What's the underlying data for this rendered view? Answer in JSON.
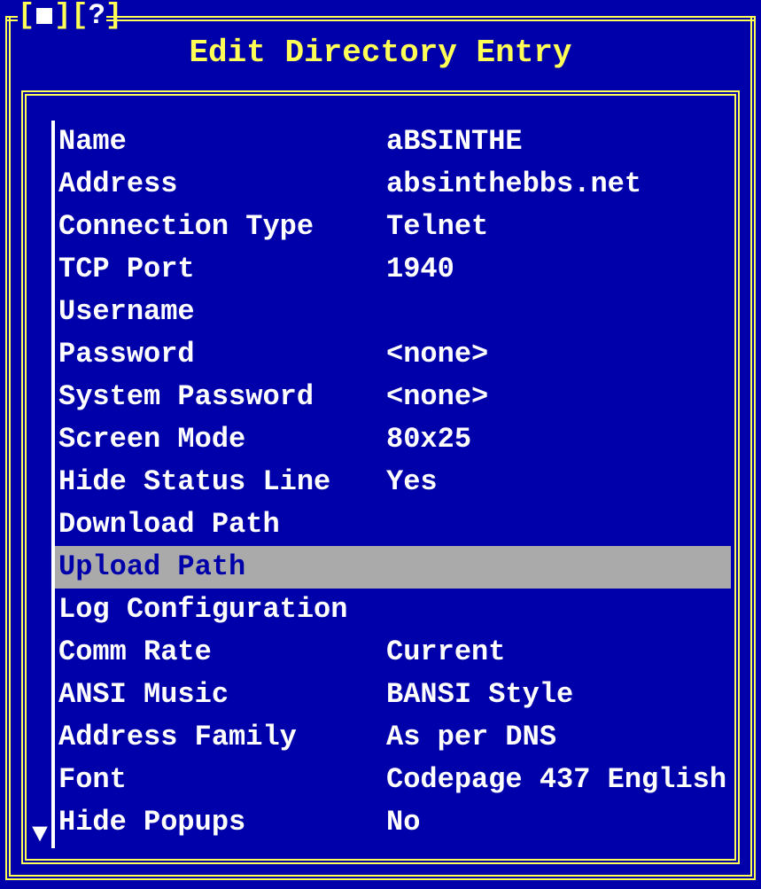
{
  "window": {
    "close_glyph": "■",
    "help_glyph": "?",
    "title": "Edit Directory Entry"
  },
  "fields": [
    {
      "label": "Name",
      "value": "aBSINTHE",
      "selected": false
    },
    {
      "label": "Address",
      "value": "absinthebbs.net",
      "selected": false
    },
    {
      "label": "Connection Type",
      "value": "Telnet",
      "selected": false
    },
    {
      "label": "TCP Port",
      "value": "1940",
      "selected": false
    },
    {
      "label": "Username",
      "value": "",
      "selected": false
    },
    {
      "label": "Password",
      "value": "<none>",
      "selected": false
    },
    {
      "label": "System Password",
      "value": "<none>",
      "selected": false
    },
    {
      "label": "Screen Mode",
      "value": "80x25",
      "selected": false
    },
    {
      "label": "Hide Status Line",
      "value": "Yes",
      "selected": false
    },
    {
      "label": "Download Path",
      "value": "",
      "selected": false
    },
    {
      "label": "Upload Path",
      "value": "",
      "selected": true
    },
    {
      "label": "Log Configuration",
      "value": "",
      "selected": false
    },
    {
      "label": "Comm Rate",
      "value": "Current",
      "selected": false
    },
    {
      "label": "ANSI Music",
      "value": "BANSI Style",
      "selected": false
    },
    {
      "label": "Address Family",
      "value": "As per DNS",
      "selected": false
    },
    {
      "label": "Font",
      "value": "Codepage 437 English",
      "selected": false
    },
    {
      "label": "Hide Popups",
      "value": "No",
      "selected": false
    }
  ],
  "scroll_down_glyph": "▼"
}
